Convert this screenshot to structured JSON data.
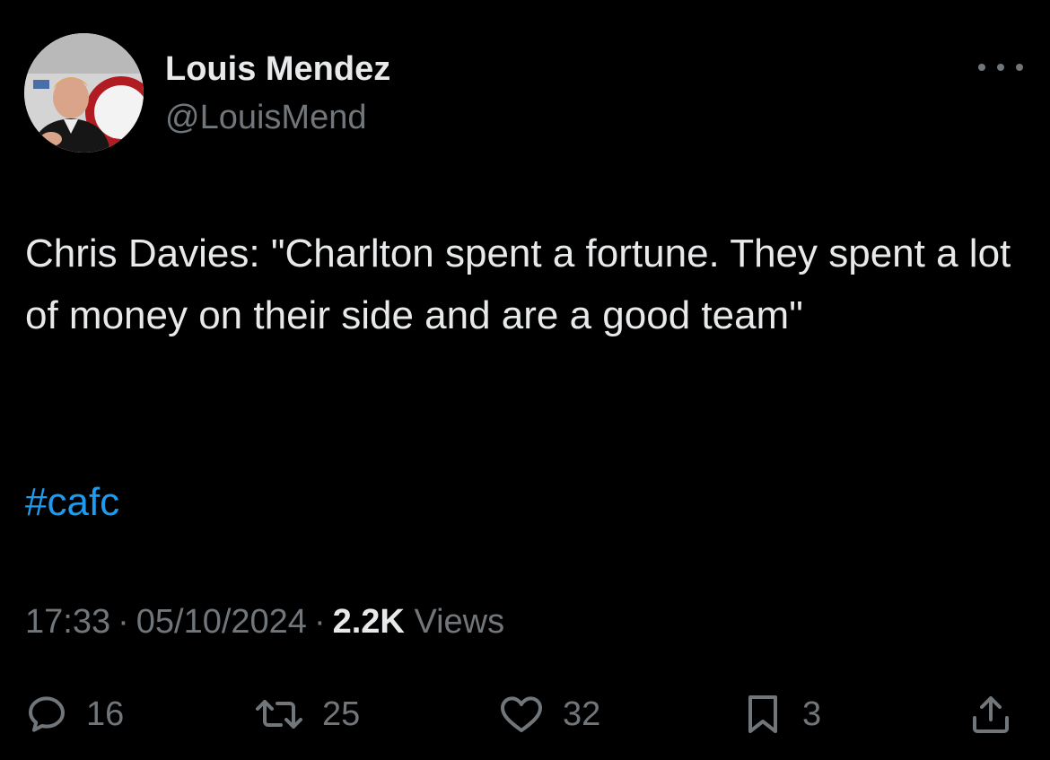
{
  "author": {
    "display_name": "Louis Mendez",
    "handle": "@LouisMend",
    "avatar_icon": "profile-photo"
  },
  "tweet": {
    "text": "Chris Davies: \"Charlton spent a fortune. They spent a lot of money on their side and are a good team\"",
    "hashtag": "#cafc"
  },
  "meta": {
    "time": "17:33",
    "separator": "·",
    "date": "05/10/2024",
    "views_count": "2.2K",
    "views_label": "Views"
  },
  "actions": {
    "replies": "16",
    "retweets": "25",
    "likes": "32",
    "bookmarks": "3"
  },
  "colors": {
    "background": "#000000",
    "text": "#e7e9ea",
    "secondary": "#71767b",
    "link": "#1d9bf0"
  },
  "icons": [
    "more-icon",
    "reply-icon",
    "retweet-icon",
    "like-icon",
    "bookmark-icon",
    "share-icon"
  ]
}
